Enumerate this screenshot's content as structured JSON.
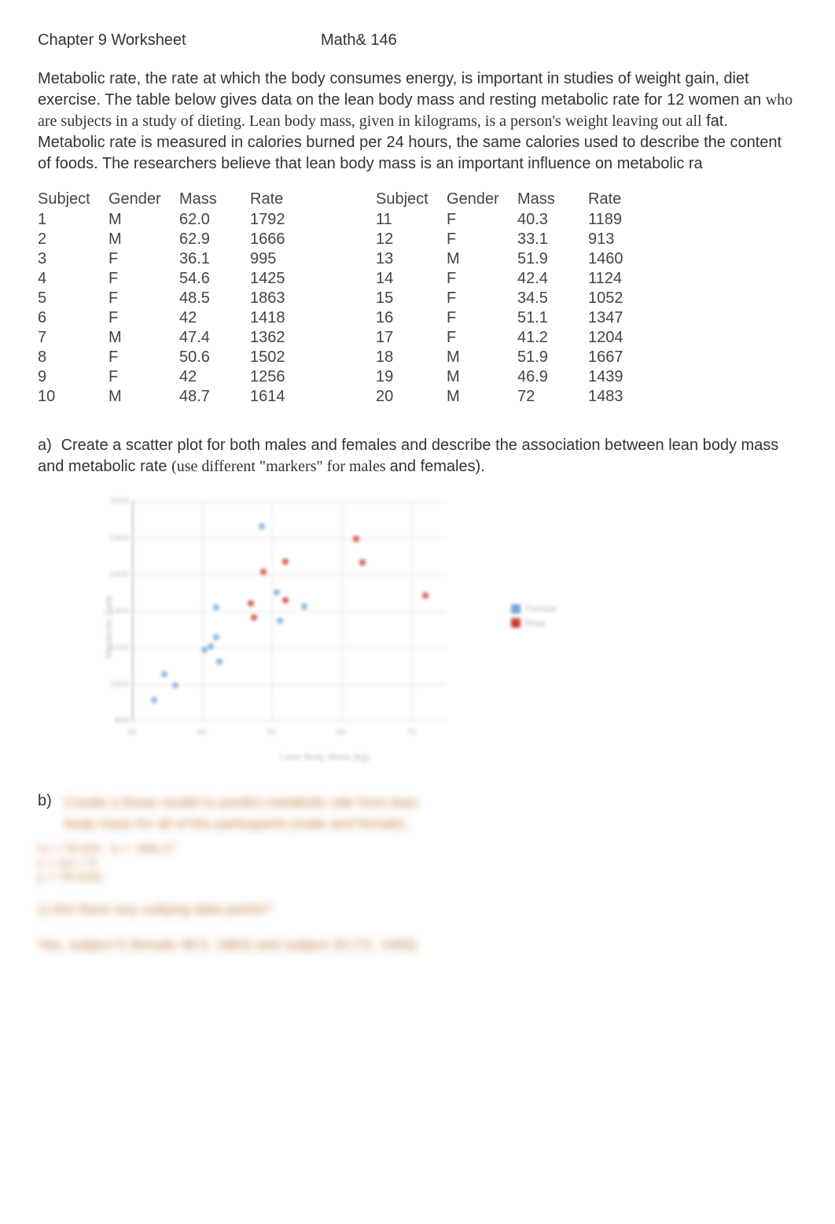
{
  "header": {
    "left": "Chapter 9 Worksheet",
    "right": "Math& 146"
  },
  "intro": {
    "part1": "Metabolic rate, the rate at which the body consumes energy, is important in studies of weight gain, diet exercise. The table below gives data on the lean body mass and resting metabolic rate for 12 women an",
    "serif": "who are subjects in a study of dieting.  Lean body mass, given in kilograms, is a person's weight leaving out all",
    "part2": "fat. Metabolic rate is measured in calories burned per 24 hours, the same calories used to describe the content of foods. The researchers believe that lean body mass is an important influence on metabolic ra"
  },
  "table": {
    "headers": [
      "Subject",
      "Gender",
      "Mass",
      "Rate",
      "Subject",
      "Gender",
      "Mass",
      "Rate"
    ],
    "rows": [
      [
        "1",
        "M",
        "62.0",
        "1792",
        "11",
        "F",
        "40.3",
        "1189"
      ],
      [
        "2",
        "M",
        "62.9",
        "1666",
        "12",
        "F",
        "33.1",
        "913"
      ],
      [
        "3",
        "F",
        "36.1",
        "995",
        "13",
        "M",
        "51.9",
        "1460"
      ],
      [
        "4",
        "F",
        "54.6",
        "1425",
        "14",
        "F",
        "42.4",
        "1124"
      ],
      [
        "5",
        "F",
        "48.5",
        "1863",
        "15",
        "F",
        "34.5",
        "1052"
      ],
      [
        "6",
        "F",
        "42",
        "1418",
        "16",
        "F",
        "51.1",
        "1347"
      ],
      [
        "7",
        "M",
        "47.4",
        "1362",
        "17",
        "F",
        "41.2",
        "1204"
      ],
      [
        "8",
        "F",
        "50.6",
        "1502",
        "18",
        "M",
        "51.9",
        "1667"
      ],
      [
        "9",
        "F",
        "42",
        "1256",
        "19",
        "M",
        "46.9",
        "1439"
      ],
      [
        "10",
        "M",
        "48.7",
        "1614",
        "20",
        "M",
        "72",
        "1483"
      ]
    ]
  },
  "question_a": {
    "label": "a)",
    "text1": "Create a scatter plot for both males and females and describe the association between lean body mass and metabolic rate ",
    "serif": "(use different \"markers\" for males ",
    "text2": "and females)."
  },
  "question_b": {
    "label": "b)",
    "blurred_lines": [
      "Create a linear model to predict metabolic rate from lean",
      "body mass for all of the participants (male and female)."
    ]
  },
  "eq_block": [
    "m = 78.024 , b = -488.27",
    "y = mx + b",
    "y = 78.024x"
  ],
  "question_c_blur": "c) Are there any outlying data points?",
  "answer_c_blur": "Yes, subject 5 (female 48.5, 1863) and subject 20 (72, 1483)",
  "chart_data": {
    "type": "scatter",
    "title": "",
    "xlabel": "Lean Body Mass (kg)",
    "ylabel": "Metabolic Rate",
    "xlim": [
      30,
      75
    ],
    "ylim": [
      800,
      2000
    ],
    "x_ticks": [
      30,
      40,
      50,
      60,
      70
    ],
    "y_ticks": [
      800,
      1000,
      1200,
      1400,
      1600,
      1800,
      2000
    ],
    "series": [
      {
        "name": "Female",
        "color": "#6fa8dc",
        "points": [
          {
            "x": 36.1,
            "y": 995
          },
          {
            "x": 54.6,
            "y": 1425
          },
          {
            "x": 48.5,
            "y": 1863
          },
          {
            "x": 42,
            "y": 1418
          },
          {
            "x": 50.6,
            "y": 1502
          },
          {
            "x": 42,
            "y": 1256
          },
          {
            "x": 40.3,
            "y": 1189
          },
          {
            "x": 33.1,
            "y": 913
          },
          {
            "x": 42.4,
            "y": 1124
          },
          {
            "x": 34.5,
            "y": 1052
          },
          {
            "x": 51.1,
            "y": 1347
          },
          {
            "x": 41.2,
            "y": 1204
          }
        ]
      },
      {
        "name": "Male",
        "color": "#cc3b2f",
        "points": [
          {
            "x": 62.0,
            "y": 1792
          },
          {
            "x": 62.9,
            "y": 1666
          },
          {
            "x": 47.4,
            "y": 1362
          },
          {
            "x": 48.7,
            "y": 1614
          },
          {
            "x": 51.9,
            "y": 1460
          },
          {
            "x": 51.9,
            "y": 1667
          },
          {
            "x": 46.9,
            "y": 1439
          },
          {
            "x": 72,
            "y": 1483
          }
        ]
      }
    ],
    "legend": [
      "Female",
      "Male"
    ]
  }
}
